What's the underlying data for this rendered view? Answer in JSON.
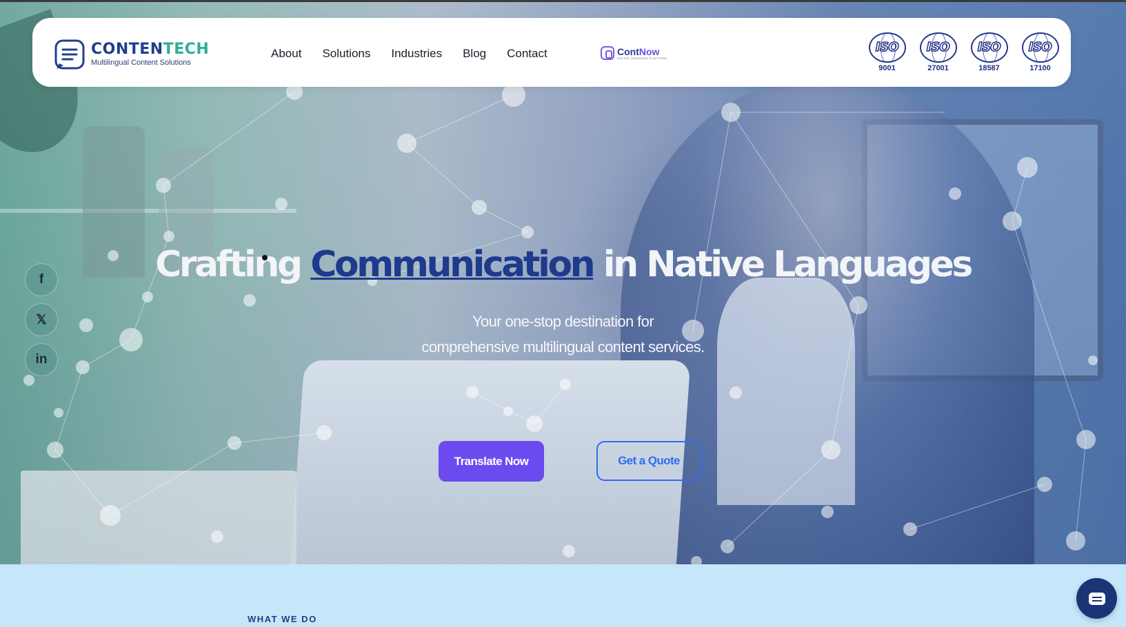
{
  "brand": {
    "name_part1": "CONTEN",
    "name_part2": "TECH",
    "tagline": "Multilingual Content Solutions"
  },
  "nav": {
    "items": [
      {
        "label": "About"
      },
      {
        "label": "Solutions"
      },
      {
        "label": "Industries"
      },
      {
        "label": "Blog"
      },
      {
        "label": "Contact"
      }
    ]
  },
  "contnow": {
    "name_part1": "Cont",
    "name_part2": "Now",
    "sub": "ONLINE ORDERING PLATFORM"
  },
  "iso_badges": [
    {
      "word": "ISO",
      "number": "9001"
    },
    {
      "word": "ISO",
      "number": "27001"
    },
    {
      "word": "ISO",
      "number": "18587"
    },
    {
      "word": "ISO",
      "number": "17100"
    }
  ],
  "social": {
    "facebook": "f",
    "x": "𝕏",
    "linkedin": "in"
  },
  "hero": {
    "headline_pre": "Crafting ",
    "headline_highlight": "Communication",
    "headline_post": " in Native Languages",
    "subline1": "Your one-stop destination for",
    "subline2": "comprehensive multilingual content services.",
    "primary_cta": "Translate Now",
    "secondary_cta": "Get a Quote"
  },
  "section": {
    "label": "WHAT WE DO"
  },
  "colors": {
    "brand_blue": "#1f3f8a",
    "brand_teal": "#2cae9a",
    "primary_button": "#6b4bf0",
    "secondary_button": "#2d6ef0",
    "section_bg": "#c6e6fa",
    "chat_button": "#1a3576"
  },
  "icons": [
    "logo-icon",
    "contnow-icon",
    "facebook-icon",
    "x-icon",
    "linkedin-icon",
    "chat-icon"
  ]
}
